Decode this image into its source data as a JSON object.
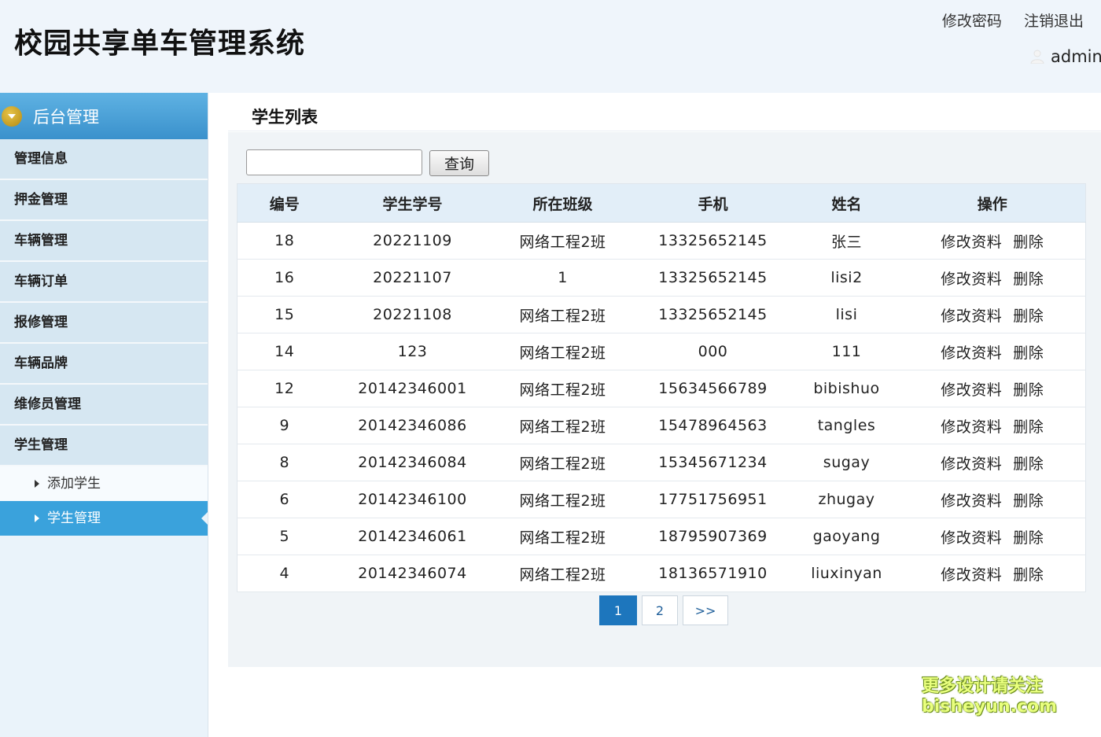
{
  "header": {
    "title": "校园共享单车管理系统",
    "change_password": "修改密码",
    "logout": "注销退出",
    "username": "admin"
  },
  "sidebar": {
    "head": "后台管理",
    "items": [
      "管理信息",
      "押金管理",
      "车辆管理",
      "车辆订单",
      "报修管理",
      "车辆品牌",
      "维修员管理",
      "学生管理"
    ],
    "sub_items": [
      "添加学生",
      "学生管理"
    ],
    "active_sub": "学生管理"
  },
  "main": {
    "page_title": "学生列表",
    "search": {
      "value": "",
      "button": "查询"
    },
    "columns": [
      "编号",
      "学生学号",
      "所在班级",
      "手机",
      "姓名",
      "操作"
    ],
    "rows": [
      [
        "18",
        "20221109",
        "网络工程2班",
        "13325652145",
        "张三"
      ],
      [
        "16",
        "20221107",
        "1",
        "13325652145",
        "lisi2"
      ],
      [
        "15",
        "20221108",
        "网络工程2班",
        "13325652145",
        "lisi"
      ],
      [
        "14",
        "123",
        "网络工程2班",
        "000",
        "111"
      ],
      [
        "12",
        "20142346001",
        "网络工程2班",
        "15634566789",
        "bibishuo"
      ],
      [
        "9",
        "20142346086",
        "网络工程2班",
        "15478964563",
        "tangles"
      ],
      [
        "8",
        "20142346084",
        "网络工程2班",
        "15345671234",
        "sugay"
      ],
      [
        "6",
        "20142346100",
        "网络工程2班",
        "17751756951",
        "zhugay"
      ],
      [
        "5",
        "20142346061",
        "网络工程2班",
        "18795907369",
        "gaoyang"
      ],
      [
        "4",
        "20142346074",
        "网络工程2班",
        "18136571910",
        "liuxinyan"
      ]
    ],
    "actions": {
      "edit": "修改资料",
      "delete": "删除"
    },
    "pager": [
      "1",
      "2",
      ">>"
    ],
    "current_page": "1"
  },
  "watermark": {
    "line1": "更多设计请关注",
    "line2": "bisheyun.com"
  }
}
